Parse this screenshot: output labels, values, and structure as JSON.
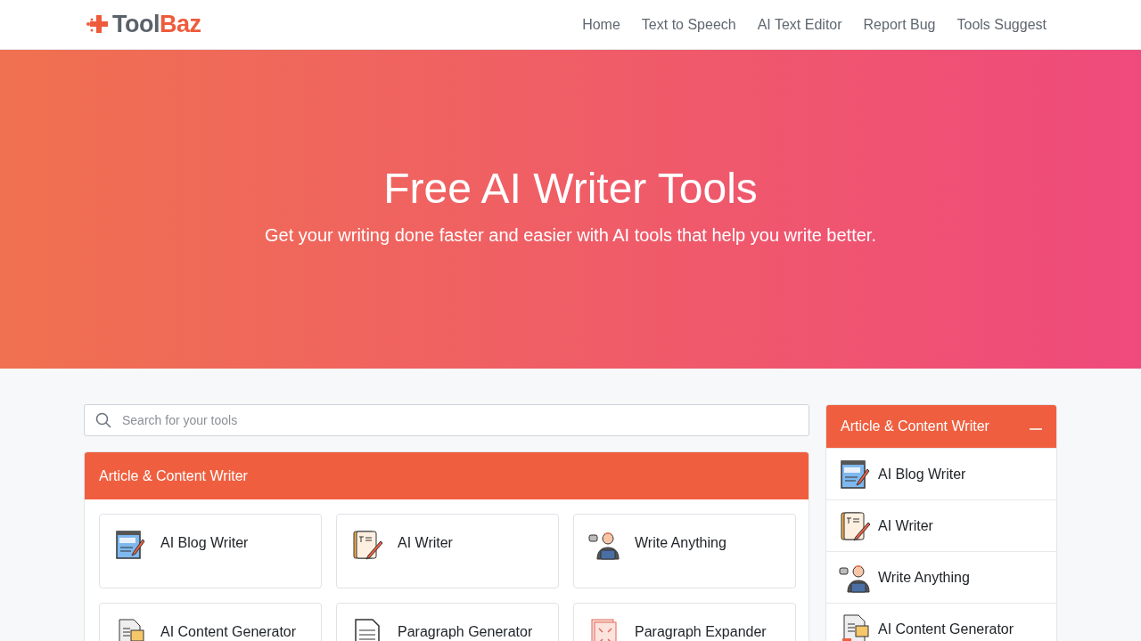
{
  "logo": {
    "part_1": "Tool",
    "part_2": "Baz"
  },
  "nav": [
    "Home",
    "Text to Speech",
    "AI Text Editor",
    "Report Bug",
    "Tools Suggest"
  ],
  "hero": {
    "title": "Free AI Writer Tools",
    "subtitle": "Get your writing done faster and easier with AI tools that help you write better."
  },
  "search": {
    "placeholder": "Search for your tools"
  },
  "category": {
    "title": "Article & Content Writer",
    "tools": [
      {
        "name": "AI Blog Writer",
        "kind": "blog"
      },
      {
        "name": "AI Writer",
        "kind": "writer"
      },
      {
        "name": "Write Anything",
        "kind": "person"
      },
      {
        "name": "AI Content Generator",
        "kind": "content"
      },
      {
        "name": "Paragraph Generator",
        "kind": "paragraph"
      },
      {
        "name": "Paragraph Expander",
        "kind": "expander"
      }
    ]
  },
  "sidebar": {
    "title": "Article & Content Writer",
    "expanded": true,
    "items": [
      {
        "name": "AI Blog Writer",
        "kind": "blog"
      },
      {
        "name": "AI Writer",
        "kind": "writer"
      },
      {
        "name": "Write Anything",
        "kind": "person"
      },
      {
        "name": "AI Content Generator",
        "kind": "content"
      }
    ]
  }
}
